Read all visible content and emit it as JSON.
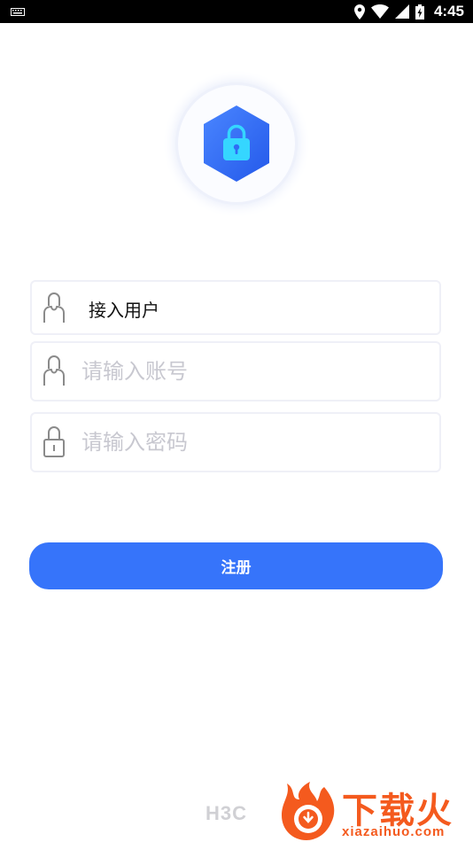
{
  "status_bar": {
    "time": "4:45",
    "icons": [
      "keyboard-icon",
      "location-icon",
      "wifi-icon",
      "signal-icon",
      "battery-icon"
    ]
  },
  "logo": {
    "icon": "lock-icon",
    "color": "#2f6cf5"
  },
  "form": {
    "user_type": {
      "value": "接入用户",
      "icon": "user-icon"
    },
    "account": {
      "placeholder": "请输入账号",
      "icon": "user-icon"
    },
    "password": {
      "placeholder": "请输入密码",
      "icon": "lock-icon"
    },
    "submit_label": "注册"
  },
  "footer": {
    "brand": "H3C"
  },
  "watermark": {
    "brand": "下载火",
    "domain": "xiazaihuo.com"
  },
  "colors": {
    "accent": "#3674fa",
    "placeholder": "#c8c8d0",
    "watermark": "#f45a1e"
  }
}
